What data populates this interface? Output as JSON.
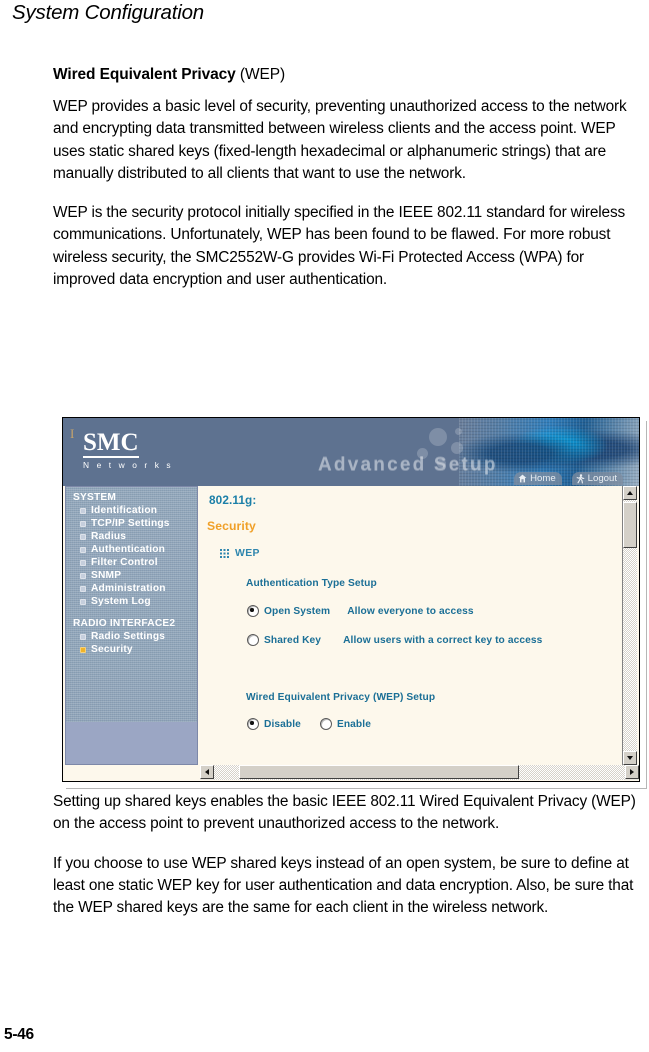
{
  "running_head": "System Configuration",
  "folio": "5-46",
  "section": {
    "heading_bold": "Wired Equivalent Privacy",
    "heading_regular": " (WEP)",
    "paragraphs_above": [
      "WEP provides a basic level of security, preventing unauthorized access to the network and encrypting data transmitted between wireless clients and the access point. WEP uses static shared keys (fixed-length hexadecimal or alphanumeric strings) that are manually distributed to all clients that want to use the network.",
      "WEP is the security protocol initially specified in the IEEE 802.11 standard for wireless communications. Unfortunately, WEP has been found to be flawed. For more robust wireless security, the SMC2552W-G provides Wi-Fi Protected Access (WPA) for improved data encryption and user authentication."
    ],
    "paragraphs_below": [
      "Setting up shared keys enables the basic IEEE 802.11 Wired Equivalent Privacy (WEP) on the access point to prevent unauthorized access to the network.",
      "If you choose to use WEP shared keys instead of an open system, be sure to define at least one static WEP key for user authentication and data encryption. Also, be sure that the WEP shared keys are the same for each client in the wireless network."
    ]
  },
  "screenshot": {
    "banner": {
      "logo_mark": "SMC",
      "logo_sub": "N e t w o r k s",
      "title": "Advanced Setup",
      "nav": [
        {
          "label": "Home",
          "icon": "home-icon"
        },
        {
          "label": "Logout",
          "icon": "logout-icon"
        }
      ]
    },
    "sidebar": {
      "groups": [
        {
          "title": "SYSTEM",
          "items": [
            {
              "label": "Identification",
              "active": false
            },
            {
              "label": "TCP/IP Settings",
              "active": false
            },
            {
              "label": "Radius",
              "active": false
            },
            {
              "label": "Authentication",
              "active": false
            },
            {
              "label": "Filter Control",
              "active": false
            },
            {
              "label": "SNMP",
              "active": false
            },
            {
              "label": "Administration",
              "active": false
            },
            {
              "label": "System Log",
              "active": false
            }
          ]
        },
        {
          "title": "RADIO INTERFACE2",
          "items": [
            {
              "label": "Radio Settings",
              "active": false
            },
            {
              "label": "Security",
              "active": true
            }
          ]
        }
      ]
    },
    "main": {
      "band_label": "802.11g:",
      "page_title": "Security",
      "section_label": "WEP",
      "auth_title": "Authentication Type Setup",
      "auth_options": [
        {
          "label": "Open System",
          "description": "Allow everyone to access",
          "selected": true
        },
        {
          "label": "Shared Key",
          "description": "Allow users with a correct key to access",
          "selected": false
        }
      ],
      "wep_title": "Wired Equivalent Privacy (WEP) Setup",
      "wep_options": [
        {
          "label": "Disable",
          "selected": true
        },
        {
          "label": "Enable",
          "selected": false
        }
      ]
    },
    "colors": {
      "banner_bg": "#5e7290",
      "sidebar_bg": "#8ea3b9",
      "content_bg": "#fdf8ec",
      "accent_orange": "#f0a028",
      "accent_blue": "#1b7fa8",
      "active_bullet": "#f0b429"
    }
  }
}
